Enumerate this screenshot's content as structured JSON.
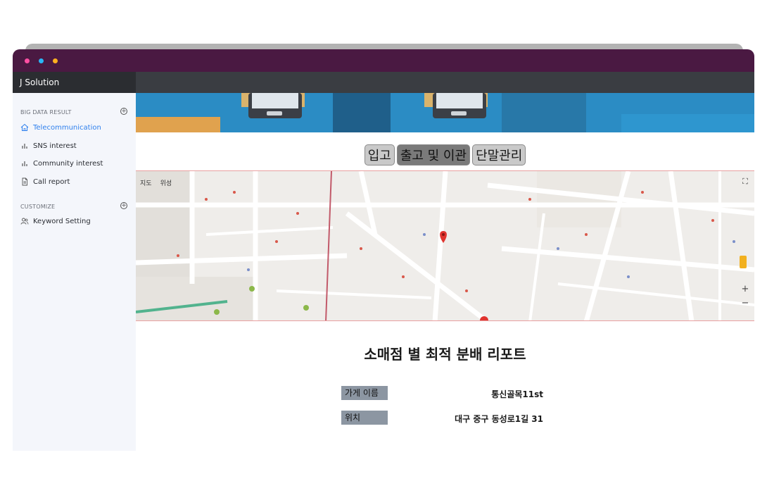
{
  "app": {
    "title": "J Solution"
  },
  "sidebar": {
    "sections": [
      {
        "header": "BIG DATA RESULT",
        "items": [
          {
            "label": "Telecommunication",
            "icon": "home-icon",
            "active": true
          },
          {
            "label": "SNS interest",
            "icon": "bar-chart-icon"
          },
          {
            "label": "Community interest",
            "icon": "bar-chart-icon"
          },
          {
            "label": "Call report",
            "icon": "document-icon"
          }
        ]
      },
      {
        "header": "CUSTOMIZE",
        "items": [
          {
            "label": "Keyword Setting",
            "icon": "users-icon"
          }
        ]
      }
    ]
  },
  "tabs": [
    {
      "label": "입고"
    },
    {
      "label": "출고 및 이관",
      "active": true
    },
    {
      "label": "단말관리"
    }
  ],
  "map": {
    "type_options": [
      "지도",
      "위성"
    ],
    "zoom_in": "+",
    "zoom_out": "−"
  },
  "report": {
    "title": "소매점 별 최적 분배 리포트",
    "fields": [
      {
        "label": "가게 이름",
        "value": "통신골목11st"
      },
      {
        "label": "위치",
        "value": "대구 중구 동성로1길 31"
      }
    ]
  },
  "colors": {
    "titlebar": "#4a1942",
    "accent": "#2f80ed",
    "banner": "#2b8cc4",
    "label_bg": "#8c96a2"
  }
}
